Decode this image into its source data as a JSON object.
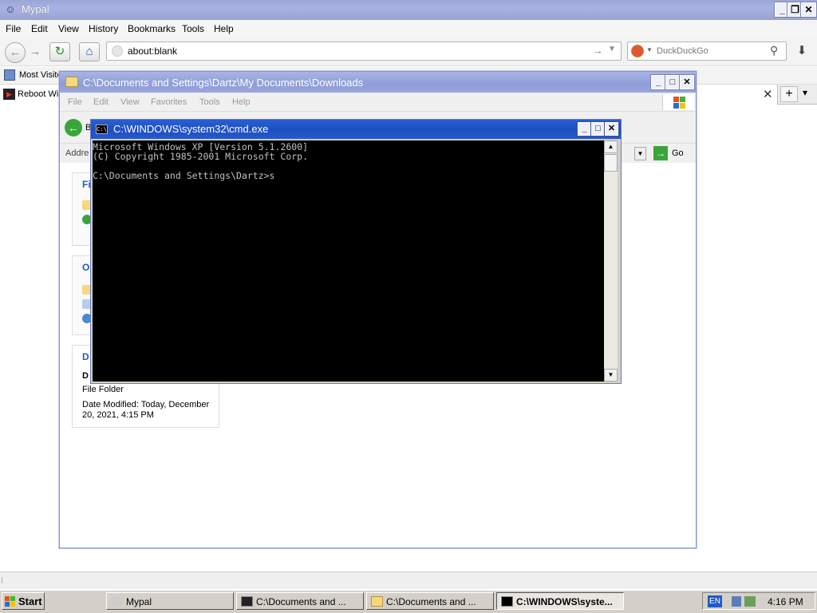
{
  "browser": {
    "title": "Mypal",
    "menu": [
      "File",
      "Edit",
      "View",
      "History",
      "Bookmarks",
      "Tools",
      "Help"
    ],
    "url": "about:blank",
    "search_placeholder": "DuckDuckGo",
    "bookmark": "Most Visite",
    "tab_label": "Reboot Wi"
  },
  "explorer": {
    "title": "C:\\Documents and Settings\\Dartz\\My Documents\\Downloads",
    "menu": [
      "File",
      "Edit",
      "View",
      "Favorites",
      "Tools",
      "Help"
    ],
    "back_label": "B",
    "address_label": "Addre",
    "go_label": "Go",
    "panels": {
      "tasks_head": "Fi",
      "other_head": "O",
      "details_head": "D"
    },
    "details": {
      "name": "D",
      "type": "File Folder",
      "date": "Date Modified: Today, December 20, 2021, 4:15 PM"
    }
  },
  "cmd": {
    "title": "C:\\WINDOWS\\system32\\cmd.exe",
    "icon_text": "C:\\",
    "console_text": "Microsoft Windows XP [Version 5.1.2600]\n(C) Copyright 1985-2001 Microsoft Corp.\n\nC:\\Documents and Settings\\Dartz>s"
  },
  "taskbar": {
    "start": "Start",
    "tasks": [
      {
        "label": "Mypal",
        "active": false
      },
      {
        "label": "C:\\Documents and ...",
        "active": false
      },
      {
        "label": "C:\\Documents and ...",
        "active": false
      },
      {
        "label": "C:\\WINDOWS\\syste...",
        "active": true
      }
    ],
    "language": "EN",
    "clock": "4:16 PM"
  },
  "colors": {
    "xp_blue": "#2a5fd6",
    "inactive_title": "#9aa6d6",
    "console_bg": "#000000",
    "console_fg": "#c0c0c0"
  }
}
